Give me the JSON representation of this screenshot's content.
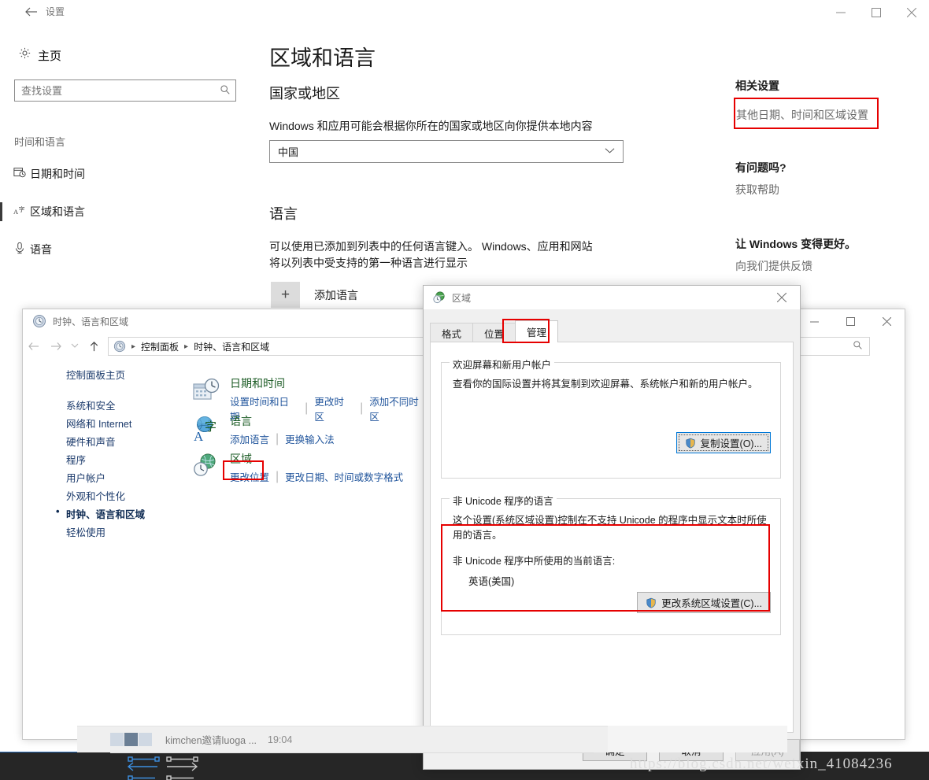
{
  "settings": {
    "titlebar": {
      "title": "设置",
      "back_icon": "back-arrow-icon",
      "minimize": "—",
      "maximize": "□",
      "close": "✕"
    },
    "sidebar": {
      "home_label": "主页",
      "home_icon": "gear-icon",
      "search": {
        "placeholder": "查找设置",
        "value": "",
        "icon": "search-icon"
      },
      "group_label": "时间和语言",
      "items": [
        {
          "label": "日期和时间",
          "icon": "calendar-clock-icon",
          "selected": false
        },
        {
          "label": "区域和语言",
          "icon": "language-a-icon",
          "selected": true
        },
        {
          "label": "语音",
          "icon": "microphone-icon",
          "selected": false
        }
      ]
    },
    "main": {
      "page_title": "区域和语言",
      "section1_title": "国家或地区",
      "section1_desc": "Windows 和应用可能会根据你所在的国家或地区向你提供本地内容",
      "country_select": {
        "value": "中国",
        "chevron": "chevron-down-icon"
      },
      "section2_title": "语言",
      "section2_desc_line1": "可以使用已添加到列表中的任何语言键入。 Windows、应用和网站",
      "section2_desc_line2": "将以列表中受支持的第一种语言进行显示",
      "add_language_label": "添加语言",
      "add_language_plus": "+"
    },
    "right_rail": {
      "related_title": "相关设置",
      "related_link": "其他日期、时间和区域设置",
      "help_title": "有问题吗?",
      "help_link": "获取帮助",
      "feedback_title": "让 Windows 变得更好。",
      "feedback_link": "向我们提供反馈"
    }
  },
  "control_panel": {
    "titlebar": {
      "title": "时钟、语言和区域",
      "icon": "control-panel-icon",
      "minimize": "—",
      "maximize": "□",
      "close": "✕"
    },
    "nav": {
      "back": "←",
      "forward": "→",
      "recent": "⌄",
      "up": "↑",
      "breadcrumb": [
        "控制面板",
        "时钟、语言和区域"
      ],
      "search_icon": "search-icon"
    },
    "left_nav": {
      "home": "控制面板主页",
      "items": [
        {
          "label": "系统和安全",
          "current": false
        },
        {
          "label": "网络和 Internet",
          "current": false
        },
        {
          "label": "硬件和声音",
          "current": false
        },
        {
          "label": "程序",
          "current": false
        },
        {
          "label": "用户帐户",
          "current": false
        },
        {
          "label": "外观和个性化",
          "current": false
        },
        {
          "label": "时钟、语言和区域",
          "current": true
        },
        {
          "label": "轻松使用",
          "current": false
        }
      ]
    },
    "categories": [
      {
        "title": "日期和时间",
        "icon": "date-time-icon",
        "links": [
          "设置时间和日期",
          "更改时区",
          "添加不同时区"
        ]
      },
      {
        "title": "语言",
        "icon": "language-globe-icon",
        "links": [
          "添加语言",
          "更换输入法"
        ]
      },
      {
        "title": "区域",
        "icon": "region-globe-icon",
        "links": [
          "更改位置",
          "更改日期、时间或数字格式"
        ]
      }
    ]
  },
  "region_dialog": {
    "titlebar": {
      "title": "区域",
      "icon": "region-globe-icon",
      "close": "✕"
    },
    "tabs": [
      {
        "label": "格式",
        "active": false
      },
      {
        "label": "位置",
        "active": false
      },
      {
        "label": "管理",
        "active": true
      }
    ],
    "group1": {
      "legend": "欢迎屏幕和新用户帐户",
      "description": "查看你的国际设置并将其复制到欢迎屏幕、系统帐户和新的用户帐户。",
      "button": "复制设置(O)...",
      "button_icon": "uac-shield-icon"
    },
    "group2": {
      "legend": "非 Unicode 程序的语言",
      "description_line1": "这个设置(系统区域设置)控制在不支持 Unicode 的程序中显示文本时所使",
      "description_line2": "用的语言。",
      "current_label": "非 Unicode 程序中所使用的当前语言:",
      "current_value": "英语(美国)",
      "button": "更改系统区域设置(C)...",
      "button_icon": "uac-shield-icon"
    },
    "footer": {
      "ok": "确定",
      "cancel": "取消",
      "apply": "应用(A)"
    }
  },
  "toast": {
    "message": "kimchen邀请luoga ...",
    "time": "19:04"
  },
  "watermark": "https://blog.csdn.net/weixin_41084236",
  "colors": {
    "highlight_red": "#e60000",
    "link_blue": "#21559c",
    "title_green": "#1b5b24",
    "focus_blue": "#0078d7"
  }
}
